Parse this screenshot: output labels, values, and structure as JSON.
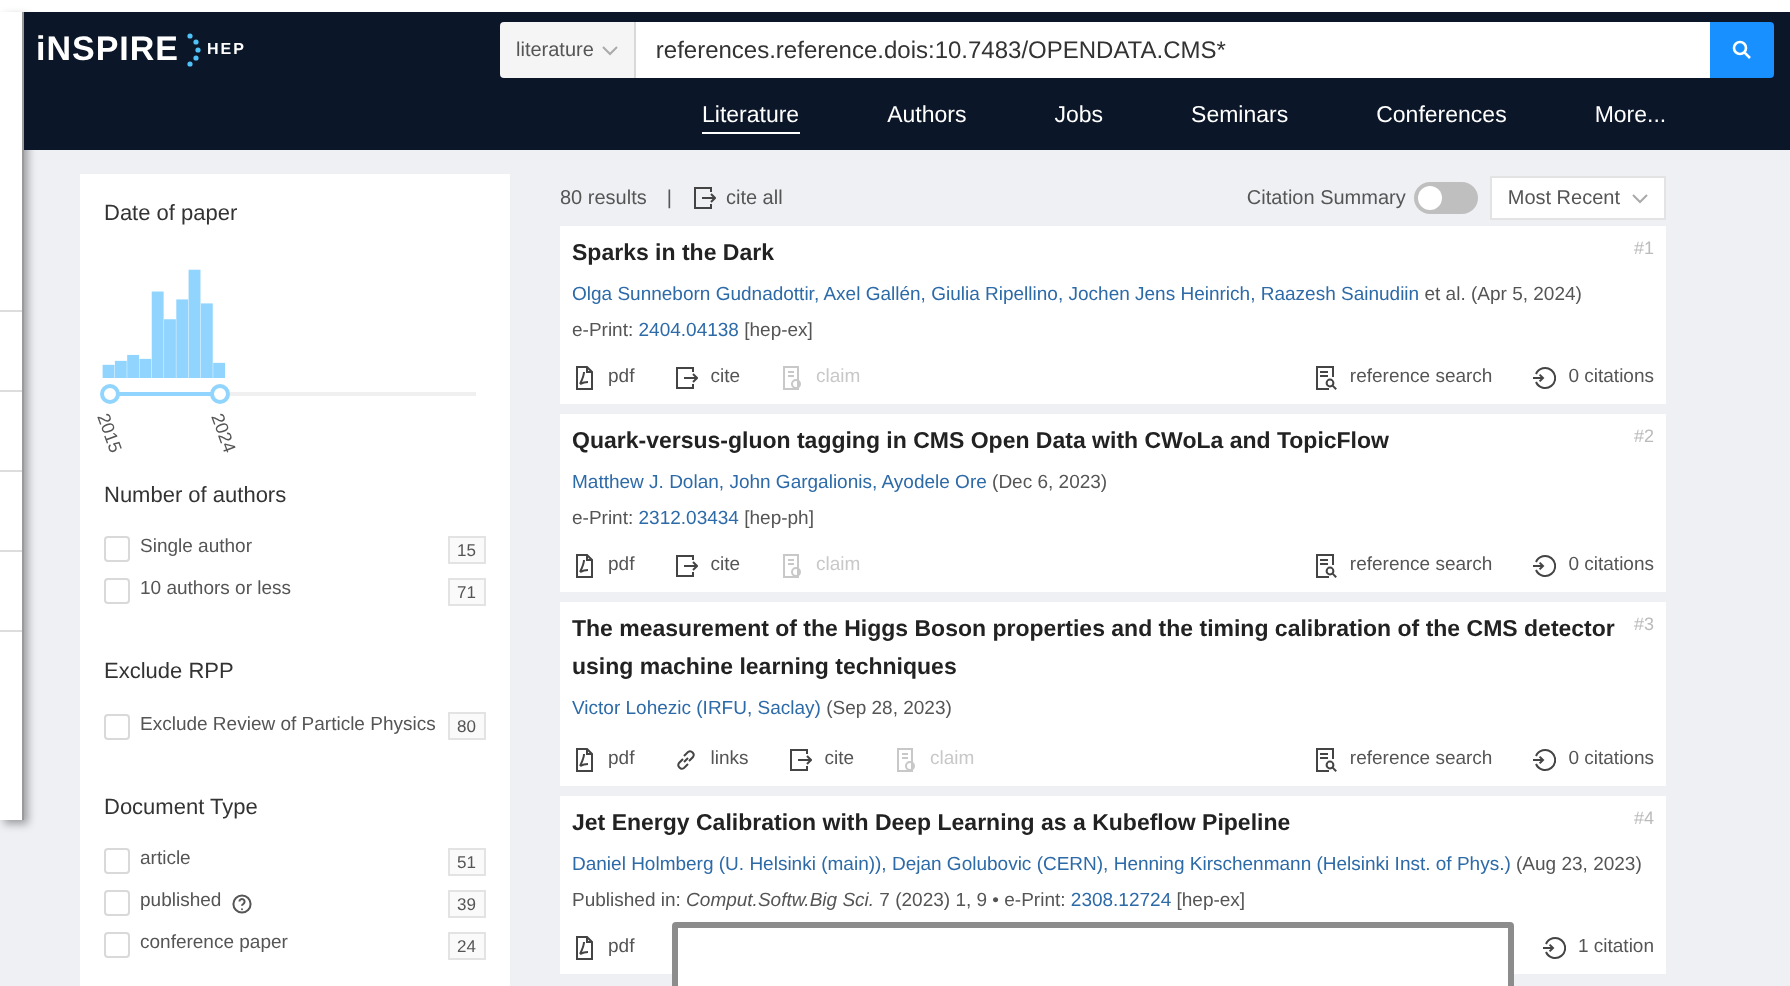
{
  "header": {
    "logo": {
      "main": "iNSPIRE",
      "sub": "HEP"
    },
    "search": {
      "collection": "literature",
      "value": "references.reference.dois:10.7483/OPENDATA.CMS*"
    },
    "nav": [
      {
        "label": "Literature",
        "selected": true
      },
      {
        "label": "Authors",
        "selected": false
      },
      {
        "label": "Jobs",
        "selected": false
      },
      {
        "label": "Seminars",
        "selected": false
      },
      {
        "label": "Conferences",
        "selected": false
      },
      {
        "label": "More...",
        "selected": false
      }
    ]
  },
  "sidebar": {
    "date_facet": {
      "title": "Date of paper",
      "range": {
        "level": 0.3,
        "start": "2015",
        "end": "2024"
      }
    },
    "facets": [
      {
        "title": "Number of authors",
        "options": [
          {
            "label": "Single author",
            "count": "15",
            "checked": false
          },
          {
            "label": "10 authors or less",
            "count": "71",
            "checked": false
          }
        ]
      },
      {
        "title": "Exclude RPP",
        "options": [
          {
            "label": "Exclude Review of Particle Physics",
            "count": "80",
            "checked": false
          }
        ]
      },
      {
        "title": "Document Type",
        "options": [
          {
            "label": "article",
            "count": "51",
            "checked": false
          },
          {
            "label": "published",
            "count": "39",
            "checked": false,
            "help": true
          },
          {
            "label": "conference paper",
            "count": "24",
            "checked": false
          }
        ]
      }
    ]
  },
  "toolbar": {
    "count": "80 results",
    "separator": "|",
    "cite_all": "cite all",
    "citation_summary": {
      "label": "Citation Summary",
      "on": false
    },
    "sort": "Most Recent"
  },
  "results": [
    {
      "rank": "#1",
      "title": "Sparks in the Dark",
      "authors": [
        {
          "name": "Olga Sunneborn Gudnadottir,"
        },
        {
          "name": "Axel Gallén,"
        },
        {
          "name": "Giulia Ripellino,"
        },
        {
          "name": "Jochen Jens Heinrich,"
        },
        {
          "name": "Raazesh Sainudiin"
        }
      ],
      "et_al": "et al.",
      "date": "(Apr 5, 2024)",
      "info": [
        {
          "kind": "text",
          "text": "e-Print:"
        },
        {
          "kind": "link",
          "text": "2404.04138"
        },
        {
          "kind": "text",
          "text": "[hep-ex]"
        }
      ],
      "actions": [
        {
          "kind": "pdf",
          "label": "pdf",
          "disabled": false
        },
        {
          "kind": "cite",
          "label": "cite",
          "disabled": false
        },
        {
          "kind": "claim",
          "label": "claim",
          "disabled": true
        }
      ],
      "right_actions": [
        {
          "kind": "reference",
          "label": "reference search"
        },
        {
          "kind": "citations",
          "label": "0 citations"
        }
      ]
    },
    {
      "rank": "#2",
      "title": "Quark-versus-gluon tagging in CMS Open Data with CWoLa and TopicFlow",
      "authors": [
        {
          "name": "Matthew J. Dolan,"
        },
        {
          "name": "John Gargalionis,"
        },
        {
          "name": "Ayodele Ore"
        }
      ],
      "date": "(Dec 6, 2023)",
      "info": [
        {
          "kind": "text",
          "text": "e-Print:"
        },
        {
          "kind": "link",
          "text": "2312.03434"
        },
        {
          "kind": "text",
          "text": "[hep-ph]"
        }
      ],
      "actions": [
        {
          "kind": "pdf",
          "label": "pdf",
          "disabled": false
        },
        {
          "kind": "cite",
          "label": "cite",
          "disabled": false
        },
        {
          "kind": "claim",
          "label": "claim",
          "disabled": true
        }
      ],
      "right_actions": [
        {
          "kind": "reference",
          "label": "reference search"
        },
        {
          "kind": "citations",
          "label": "0 citations"
        }
      ]
    },
    {
      "rank": "#3",
      "title": "The measurement of the Higgs Boson properties and the timing calibration of the CMS detector using machine learning techniques",
      "authors": [
        {
          "name": "Victor Lohezic",
          "affiliation": "(IRFU, Saclay)"
        }
      ],
      "date": "(Sep 28, 2023)",
      "actions": [
        {
          "kind": "pdf",
          "label": "pdf",
          "disabled": false
        },
        {
          "kind": "links",
          "label": "links",
          "disabled": false
        },
        {
          "kind": "cite",
          "label": "cite",
          "disabled": false
        },
        {
          "kind": "claim",
          "label": "claim",
          "disabled": true
        }
      ],
      "right_actions": [
        {
          "kind": "reference",
          "label": "reference search"
        },
        {
          "kind": "citations",
          "label": "0 citations"
        }
      ]
    },
    {
      "rank": "#4",
      "title": "Jet Energy Calibration with Deep Learning as a Kubeflow Pipeline",
      "authors": [
        {
          "name": "Daniel Holmberg",
          "affiliation": "(U. Helsinki (main)),"
        },
        {
          "name": "Dejan Golubovic",
          "affiliation": "(CERN),"
        },
        {
          "name": "Henning Kirschenmann",
          "affiliation": "(Helsinki Inst. of Phys.)"
        }
      ],
      "date": "(Aug 23, 2023)",
      "info": [
        {
          "kind": "text",
          "text": "Published in:"
        },
        {
          "kind": "journal",
          "text": "Comput.Softw.Big Sci."
        },
        {
          "kind": "text",
          "text": "7 (2023) 1, 9 • e-Print:"
        },
        {
          "kind": "link",
          "text": "2308.12724"
        },
        {
          "kind": "text",
          "text": "[hep-ex]"
        }
      ],
      "actions": [
        {
          "kind": "pdf",
          "label": "pdf",
          "disabled": false
        }
      ],
      "right_actions": [
        {
          "kind": "citations",
          "label": "1 citation"
        }
      ]
    }
  ]
}
